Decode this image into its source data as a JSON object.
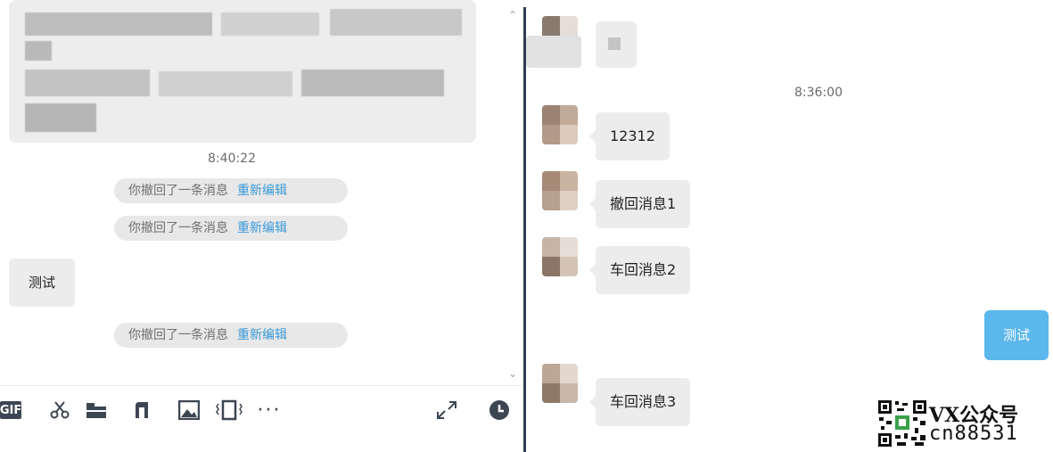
{
  "left_chat": {
    "timestamp": "8:40:22",
    "recall_notices": [
      {
        "text": "你撤回了一条消息",
        "action": "重新编辑"
      },
      {
        "text": "你撤回了一条消息",
        "action": "重新编辑"
      },
      {
        "text": "你撤回了一条消息",
        "action": "重新编辑"
      }
    ],
    "message": "测试"
  },
  "right_chat": {
    "timestamp": "8:36:00",
    "incoming_messages": [
      "12312",
      "撤回消息1",
      "车回消息2",
      "车回消息3"
    ],
    "outgoing_message": "测试"
  },
  "toolbar": {
    "gif_label": "GIF",
    "icons": [
      "gif-icon",
      "scissors-icon",
      "folder-icon",
      "music-icon",
      "image-icon",
      "screen-shake-icon",
      "more-icon",
      "expand-icon",
      "clock-icon"
    ]
  },
  "watermark": {
    "line1": "VX公众号",
    "line2": "cn88531"
  },
  "colors": {
    "divider": "#2c3e50",
    "link": "#3a9ad9",
    "outgoing_bubble": "#5cb8ec",
    "incoming_bubble": "#ececec",
    "icon": "#3c4652"
  }
}
